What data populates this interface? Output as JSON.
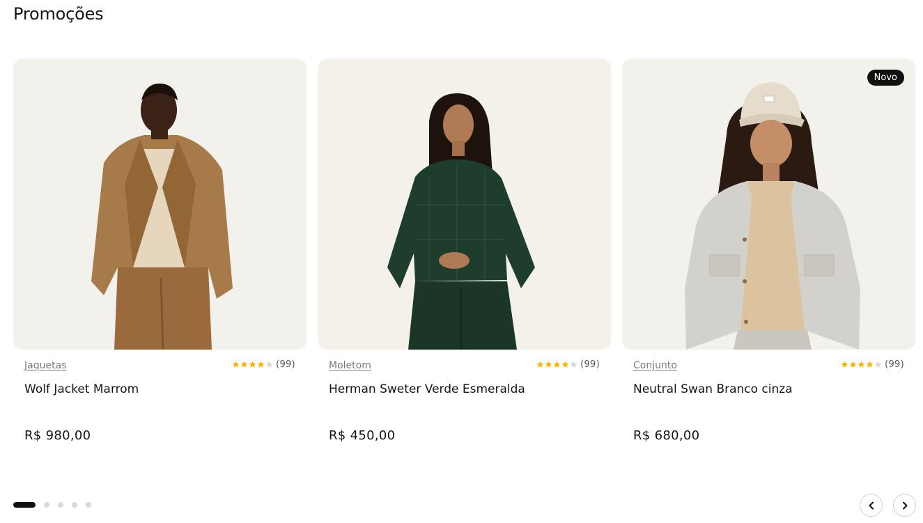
{
  "section": {
    "title": "Promoções"
  },
  "colors": {
    "accent_dark": "#111111",
    "star": "#f5b301",
    "star_empty": "#d6d6d6",
    "card_bg": "#f2f1ec"
  },
  "products": [
    {
      "category": "Jaquetas",
      "name": "Wolf Jacket Marrom",
      "price": "R$ 980,00",
      "rating": 4,
      "rating_max": 5,
      "rating_count": "(99)",
      "badge": ""
    },
    {
      "category": "Moletom",
      "name": "Herman Sweter Verde Esmeralda",
      "price": "R$ 450,00",
      "rating": 4,
      "rating_max": 5,
      "rating_count": "(99)",
      "badge": ""
    },
    {
      "category": "Conjunto",
      "name": "Neutral Swan Branco cinza",
      "price": "R$ 680,00",
      "rating": 4,
      "rating_max": 5,
      "rating_count": "(99)",
      "badge": "Novo"
    }
  ],
  "carousel": {
    "page_count": 5,
    "active_index": 0,
    "prev_icon": "chevron-left-icon",
    "next_icon": "chevron-right-icon"
  }
}
